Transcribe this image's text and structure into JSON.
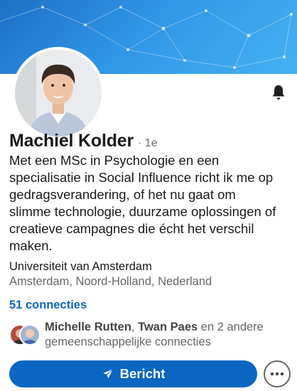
{
  "profile": {
    "name": "Machiel Kolder",
    "degree": "· 1e",
    "headline_lines": [
      "Met een MSc in Psychologie en een",
      "specialisatie in Social Influence richt ik me op",
      "gedragsverandering, of het nu gaat om",
      "slimme technologie, duurzame oplossingen of",
      "creatieve campagnes die écht het verschil",
      "maken."
    ],
    "organization": "Universiteit van Amsterdam",
    "location": "Amsterdam, Noord-Holland, Nederland",
    "connections": "51 connecties"
  },
  "mutual": {
    "name1": "Michelle Rutten",
    "separator": ", ",
    "name2": "Twan Paes",
    "rest_line1": " en 2 andere",
    "line2": "gemeenschappelijke connecties"
  },
  "actions": {
    "message_label": "Bericht"
  },
  "colors": {
    "accent": "#0a66c2",
    "banner": "#2f95e6"
  },
  "icons": {
    "bell": "bell-icon",
    "send": "send-icon",
    "more": "more-icon"
  }
}
